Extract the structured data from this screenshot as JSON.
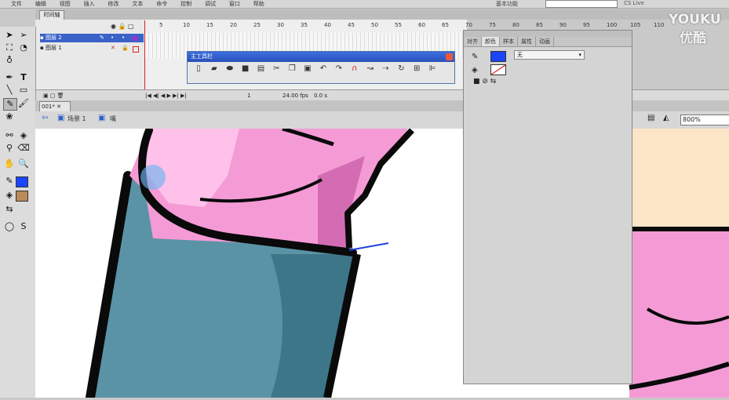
{
  "menu": [
    "文件",
    "编辑",
    "视图",
    "插入",
    "修改",
    "文本",
    "命令",
    "控制",
    "调试",
    "窗口",
    "帮助"
  ],
  "workspace": "基本功能",
  "search_placeholder": "",
  "cs_live": "CS Live",
  "timeline": {
    "tab": "时间轴",
    "layers": [
      {
        "name": "图层 2",
        "selected": true
      },
      {
        "name": "图层 1",
        "selected": false
      }
    ],
    "frame_numbers": [
      "5",
      "10",
      "15",
      "20",
      "25",
      "30",
      "35",
      "40",
      "45",
      "50",
      "55",
      "60",
      "65",
      "70",
      "75",
      "80",
      "85",
      "90",
      "95",
      "100",
      "105",
      "110"
    ],
    "current_frame": "1",
    "fps": "24.00 fps",
    "time": "0.0 s"
  },
  "document": {
    "tab": "001*",
    "scene": "场景 1",
    "symbol": "嘴",
    "zoom": "800%"
  },
  "main_toolbar": {
    "title": "主工具栏",
    "icons": [
      "new-icon",
      "open-icon",
      "bridge-icon",
      "save-icon",
      "print-icon",
      "cut-icon",
      "copy-icon",
      "paste-icon",
      "undo-icon",
      "redo-icon",
      "snap-icon",
      "smooth-icon",
      "straighten-icon",
      "rotate-icon",
      "scale-icon",
      "align-icon"
    ]
  },
  "color_panel": {
    "tabs": [
      "对齐",
      "颜色",
      "样本",
      "属性",
      "动画"
    ],
    "active_tab": "颜色",
    "type": "无",
    "stroke_color": "#1a44ff",
    "fill_color": "none"
  },
  "tools_panel": {
    "stroke_color": "#1a44ff",
    "fill_color": "#b98a5a"
  },
  "watermark": {
    "line1": "YOUKU",
    "line2": "优酷"
  },
  "colors": {
    "pink": "#f49bd6",
    "pink_light": "#ffc1ea",
    "pink_dark": "#d46cb4",
    "teal": "#5a93a5",
    "teal_dark": "#3d7589",
    "skin": "#fde6c8",
    "outline": "#0a0a0a"
  }
}
